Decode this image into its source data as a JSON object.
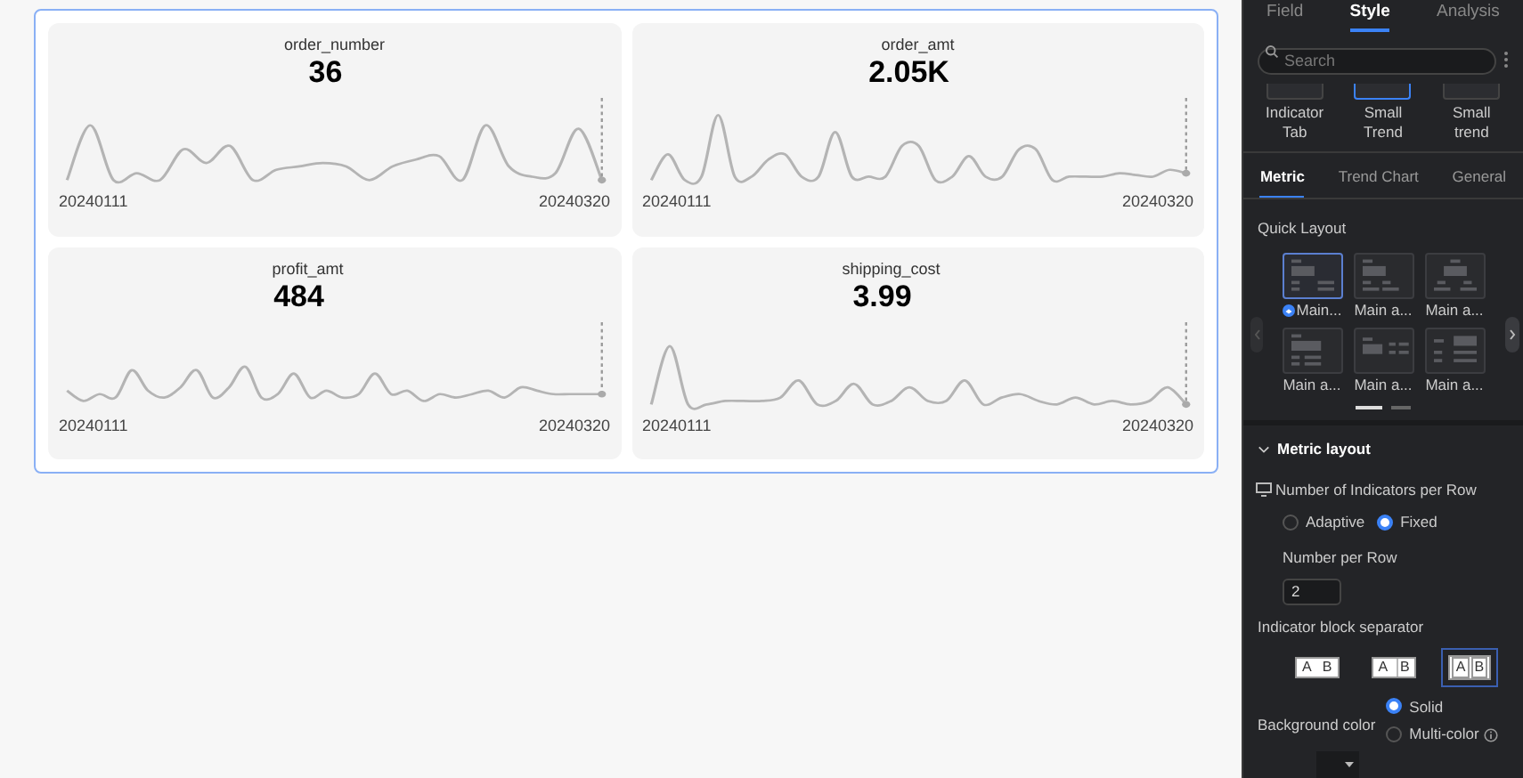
{
  "canvas": {
    "cards": [
      {
        "title": "order_number",
        "value": "36",
        "start_date": "20240111",
        "end_date": "20240320"
      },
      {
        "title": "order_amt",
        "value": "2.05K",
        "start_date": "20240111",
        "end_date": "20240320"
      },
      {
        "title": "profit_amt",
        "value": "484",
        "start_date": "20240111",
        "end_date": "20240320"
      },
      {
        "title": "shipping_cost",
        "value": "3.99",
        "start_date": "20240111",
        "end_date": "20240320"
      }
    ]
  },
  "panel": {
    "tabs": [
      {
        "label": "Field",
        "selected": false
      },
      {
        "label": "Style",
        "selected": true
      },
      {
        "label": "Analysis",
        "selected": false
      }
    ],
    "search": {
      "placeholder": "Search"
    },
    "chart_types": [
      {
        "label": "Indicator Tab",
        "selected": false
      },
      {
        "label": "Small Trend",
        "selected": true
      },
      {
        "label": "Small trend",
        "selected": false
      }
    ],
    "sub_tabs": [
      {
        "label": "Metric",
        "selected": true
      },
      {
        "label": "Trend Chart",
        "selected": false
      },
      {
        "label": "General",
        "selected": false
      }
    ],
    "quick_layout": {
      "title": "Quick Layout",
      "options": [
        {
          "label": "Main...",
          "selected": true
        },
        {
          "label": "Main a...",
          "selected": false
        },
        {
          "label": "Main a...",
          "selected": false
        },
        {
          "label": "Main a...",
          "selected": false
        },
        {
          "label": "Main a...",
          "selected": false
        },
        {
          "label": "Main a...",
          "selected": false
        }
      ]
    },
    "metric_layout": {
      "title": "Metric layout",
      "expanded": true,
      "indicators_per_row": {
        "label": "Number of Indicators per Row",
        "options": [
          {
            "label": "Adaptive",
            "selected": false
          },
          {
            "label": "Fixed",
            "selected": true
          }
        ]
      },
      "number_per_row": {
        "label": "Number per Row",
        "value": "2"
      },
      "separator": {
        "label": "Indicator block separator",
        "options": [
          {
            "left": "A",
            "right": "B",
            "selected": false
          },
          {
            "left": "A",
            "right": "B",
            "selected": false
          },
          {
            "left": "A",
            "right": "B",
            "selected": true
          }
        ]
      },
      "background_color": {
        "label": "Background color",
        "options": [
          {
            "label": "Solid",
            "selected": true
          },
          {
            "label": "Multi-color",
            "selected": false
          }
        ]
      }
    }
  }
}
